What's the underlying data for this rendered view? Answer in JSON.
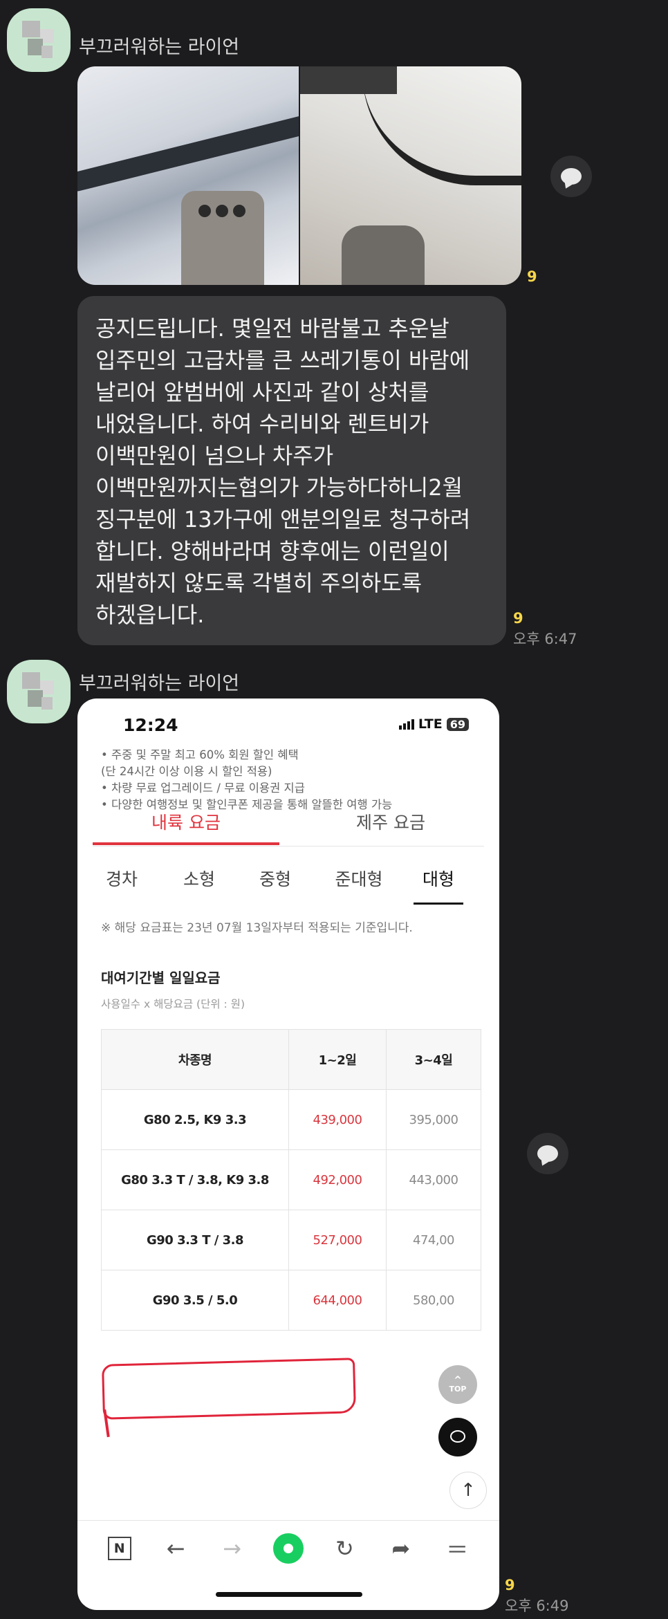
{
  "messages": [
    {
      "sender": "부끄러워하는 라이언",
      "unread": "9"
    },
    {
      "text": "공지드립니다. 몇일전 바람불고 추운날\n입주민의 고급차를 큰 쓰레기통이 바람에\n날리어 앞범버에 사진과 같이 상처를\n내었읍니다. 하여 수리비와 렌트비가\n이백만원이 넘으나 차주가\n이백만원까지는협의가 가능하다하니2월\n징구분에 13가구에 앤분의일로 청구하려\n합니다. 양해바라며 향후에는 이런일이\n재발하지 않도록 각별히 주의하도록\n하겠읍니다.",
      "unread": "9",
      "time": "오후 6:47"
    },
    {
      "sender": "부끄러워하는 라이언",
      "unread": "9",
      "time": "오후 6:49"
    }
  ],
  "screenshot": {
    "status_time": "12:24",
    "network": "LTE",
    "battery": "69",
    "benefits": [
      "• 주중 및 주말 최고 60% 회원 할인 혜택",
      "   (단 24시간 이상 이용 시 할인 적용)",
      "• 차량 무료 업그레이드 / 무료 이용권 지급",
      "• 다양한 여행정보 및 할인쿠폰 제공을 통해 알뜰한 여행 가능"
    ],
    "main_tabs": [
      "내륙 요금",
      "제주 요금"
    ],
    "sub_tabs": [
      "경차",
      "소형",
      "중형",
      "준대형",
      "대형"
    ],
    "note": "※ 해당 요금표는 23년 07월 13일자부터 적용되는 기준입니다.",
    "section_title": "대여기간별 일일요금",
    "section_sub": "사용일수 x 해당요금 (단위 : 원)",
    "table": {
      "headers": [
        "차종명",
        "1~2일",
        "3~4일"
      ],
      "rows": [
        [
          "G80 2.5, K9 3.3",
          "439,000",
          "395,000"
        ],
        [
          "G80 3.3 T / 3.8, K9 3.8",
          "492,000",
          "443,000"
        ],
        [
          "G90 3.3 T / 3.8",
          "527,000",
          "474,00"
        ],
        [
          "G90 3.5 / 5.0",
          "644,000",
          "580,00"
        ]
      ]
    },
    "top_label": "TOP"
  },
  "colors": {
    "background": "#1c1c1e",
    "bubble": "#3a3a3c",
    "unread": "#f7d64a",
    "accent_red": "#e0343f",
    "nav_green": "#19ce60"
  }
}
